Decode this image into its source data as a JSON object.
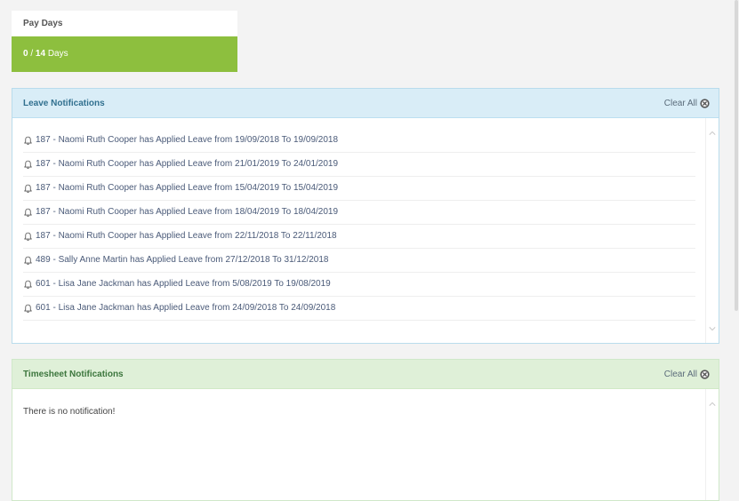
{
  "pay_days": {
    "title": "Pay Days",
    "used": "0",
    "total": "14",
    "unit": "Days"
  },
  "leave_notifications": {
    "title": "Leave Notifications",
    "clear_all_label": "Clear All",
    "items": [
      "187 - Naomi Ruth Cooper has Applied Leave from 19/09/2018 To 19/09/2018",
      "187 - Naomi Ruth Cooper has Applied Leave from 21/01/2019 To 24/01/2019",
      "187 - Naomi Ruth Cooper has Applied Leave from 15/04/2019 To 15/04/2019",
      "187 - Naomi Ruth Cooper has Applied Leave from 18/04/2019 To 18/04/2019",
      "187 - Naomi Ruth Cooper has Applied Leave from 22/11/2018 To 22/11/2018",
      "489 - Sally Anne Martin has Applied Leave from 27/12/2018 To 31/12/2018",
      "601 - Lisa Jane Jackman has Applied Leave from 5/08/2019 To 19/08/2019",
      "601 - Lisa Jane Jackman has Applied Leave from 24/09/2018 To 24/09/2018"
    ]
  },
  "timesheet_notifications": {
    "title": "Timesheet Notifications",
    "clear_all_label": "Clear All",
    "empty_message": "There is no notification!"
  },
  "icons": {
    "bell": "bell-icon",
    "clear": "close-circle-icon",
    "scroll_up": "chevron-up-icon",
    "scroll_down": "chevron-down-icon"
  },
  "colors": {
    "pay_days_accent": "#8dbf3e",
    "leave_header_bg": "#d9edf7",
    "timesheet_header_bg": "#dff0d8"
  }
}
